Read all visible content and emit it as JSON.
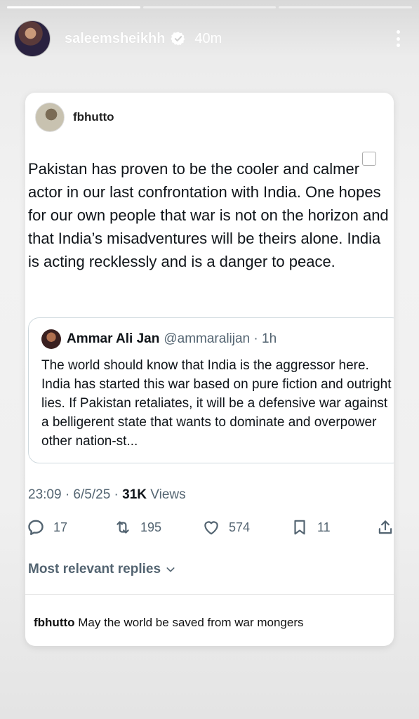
{
  "story": {
    "progress": [
      1.0,
      0.0,
      0.0
    ],
    "username": "saleemsheikhh",
    "time": "40m"
  },
  "post": {
    "author": "fbhutto",
    "text": "Pakistan has proven to be the cooler and calmer actor in our last confrontation with India. One hopes for our own people that war is not on the horizon and that India’s misadventures will be theirs alone. India is acting recklessly and is a danger to peace.",
    "quote": {
      "name": "Ammar Ali Jan",
      "handle": "@ammaralijan · 1h",
      "text": "The world should know that India is the aggressor here. India has started this war based on pure fiction and outright lies. If Pakistan retaliates, it will be a defensive war against a belligerent state that wants to dominate and overpower other nation-st..."
    },
    "timestamp": "23:09 · 6/5/25 · ",
    "views_count": "31K",
    "views_label": " Views",
    "actions": {
      "replies": "17",
      "reposts": "195",
      "likes": "574",
      "bookmarks": "11"
    },
    "replies_label": "Most relevant replies",
    "reply": {
      "user": "fbhutto",
      "text": "May the world be saved from war mongers"
    }
  },
  "icons": [
    "verified-icon",
    "more-options-icon",
    "reply-icon",
    "repost-icon",
    "like-icon",
    "bookmark-icon",
    "share-icon",
    "chevron-down-icon"
  ],
  "colors": {
    "text": "#0f1419",
    "secondary": "#536471",
    "border": "#cfd9de"
  }
}
